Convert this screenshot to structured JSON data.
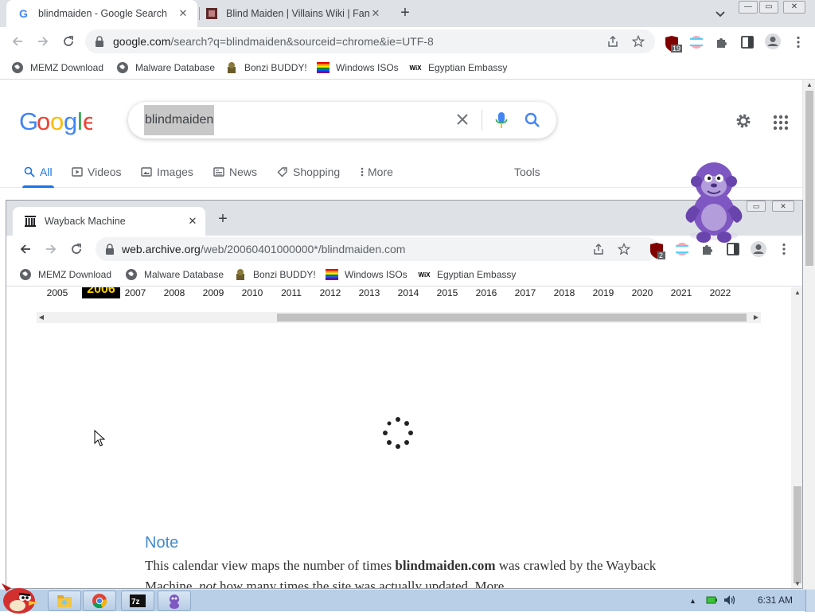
{
  "outer_browser": {
    "tabs": [
      {
        "title": "blindmaiden - Google Search",
        "active": true
      },
      {
        "title": "Blind Maiden | Villains Wiki | Fan",
        "active": false
      }
    ],
    "address": {
      "host": "google.com",
      "path": "/search?q=blindmaiden&sourceid=chrome&ie=UTF-8"
    },
    "extension_badge": "19",
    "bookmarks": [
      {
        "label": "MEMZ Download",
        "icon": "globe-icon"
      },
      {
        "label": "Malware Database",
        "icon": "globe-icon"
      },
      {
        "label": "Bonzi BUDDY!",
        "icon": "bonzi-icon"
      },
      {
        "label": "Windows ISOs",
        "icon": "rainbow-flag-icon"
      },
      {
        "label": "Egyptian Embassy",
        "icon": "wix-icon"
      }
    ]
  },
  "google": {
    "logo": "Google",
    "query": "blindmaiden",
    "tabs": [
      {
        "label": "All",
        "icon": "search-icon",
        "active": true
      },
      {
        "label": "Videos",
        "icon": "play-icon"
      },
      {
        "label": "Images",
        "icon": "image-icon"
      },
      {
        "label": "News",
        "icon": "news-icon"
      },
      {
        "label": "Shopping",
        "icon": "tag-icon"
      },
      {
        "label": "More",
        "icon": "dots-vertical-icon"
      }
    ],
    "tools": "Tools"
  },
  "inner_browser": {
    "tab_title": "Wayback Machine",
    "address": {
      "host": "web.archive.org",
      "path": "/web/20060401000000*/blindmaiden.com"
    },
    "extension_badge": "2",
    "bookmarks": [
      {
        "label": "MEMZ Download"
      },
      {
        "label": "Malware Database"
      },
      {
        "label": "Bonzi BUDDY!"
      },
      {
        "label": "Windows ISOs"
      },
      {
        "label": "Egyptian Embassy"
      }
    ]
  },
  "wayback": {
    "years": [
      "2005",
      "2006",
      "2007",
      "2008",
      "2009",
      "2010",
      "2011",
      "2012",
      "2013",
      "2014",
      "2015",
      "2016",
      "2017",
      "2018",
      "2019",
      "2020",
      "2021",
      "2022"
    ],
    "selected_year": "2006",
    "note_title": "Note",
    "note_pre": "This calendar view maps the number of times ",
    "note_site": "blindmaiden.com",
    "note_mid": " was crawled by the Wayback Machine, ",
    "note_not": "not",
    "note_post": " how many times the site was actually updated. More"
  },
  "taskbar": {
    "clock": "6:31 AM",
    "apps": [
      "explorer-icon",
      "chrome-icon",
      "7zip-icon",
      "bonzi-icon"
    ]
  },
  "colors": {
    "google_blue": "#4285f4",
    "google_red": "#ea4335",
    "google_yellow": "#fbbc05",
    "google_green": "#34a853",
    "wayback_selected_bg": "#000000",
    "wayback_selected_fg": "#ffd200",
    "note_title": "#428bca"
  }
}
